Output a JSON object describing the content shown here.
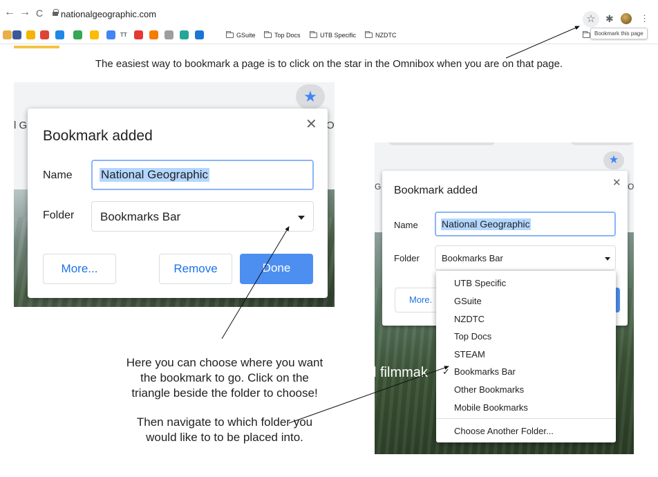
{
  "browser": {
    "url": "nationalgeographic.com",
    "back_glyph": "←",
    "forward_glyph": "→",
    "reload_glyph": "C",
    "star_glyph": "☆",
    "extensions_glyph": "✱",
    "menu_glyph": "⋮",
    "bookmarks_bar": {
      "favicon_colors": [
        "#e8b04a",
        "#3b5998",
        "#f4b400",
        "#db4437",
        "#1e88e5",
        "#34a853",
        "#fbbc04",
        "#4285f4",
        "#e53935",
        "#f57c00",
        "#9e9e9e",
        "#26a69a",
        "#1976d2"
      ],
      "tt_label": "TT",
      "folders": [
        "GSuite",
        "Top Docs",
        "UTB Specific",
        "NZDTC"
      ],
      "tooltip": "Bookmark this page"
    }
  },
  "captions": {
    "top": "The easiest way to bookmark a page is to click on the star in the Omnibox when you are on that page.",
    "middle_line1": "Here you can choose where you want",
    "middle_line2": "the bookmark to go. Click on the",
    "middle_line3": "triangle beside the folder to choose!",
    "bottom_line1": "Then navigate to which folder you",
    "bottom_line2": "would like to to be placed into."
  },
  "left_dialog": {
    "bg_fragment_left": "l G",
    "bg_fragment_right": "Ot",
    "star_glyph": "★",
    "title": "Bookmark added",
    "close_glyph": "✕",
    "name_label": "Name",
    "name_value": "National Geographic",
    "folder_label": "Folder",
    "folder_value": "Bookmarks Bar",
    "more_button": "More...",
    "remove_button": "Remove",
    "done_button": "Done"
  },
  "right_dialog": {
    "bg_fragment_left": "G",
    "bg_fragment_right": "Ot",
    "bg_text": "l filmmak",
    "star_glyph": "★",
    "title": "Bookmark added",
    "close_glyph": "✕",
    "name_label": "Name",
    "name_value": "National Geographic",
    "folder_label": "Folder",
    "folder_value": "Bookmarks Bar",
    "more_button": "More.",
    "check_glyph": "✓",
    "folder_options": [
      "UTB Specific",
      "GSuite",
      "NZDTC",
      "Top Docs",
      "STEAM",
      "Bookmarks Bar",
      "Other Bookmarks",
      "Mobile Bookmarks"
    ],
    "selected_option": "Bookmarks Bar",
    "choose_other": "Choose Another Folder..."
  },
  "colors": {
    "accent_blue": "#1a73e8",
    "done_blue": "#4d8ff1",
    "star_blue": "#4285f4",
    "selection_blue": "#b3d7ff"
  }
}
